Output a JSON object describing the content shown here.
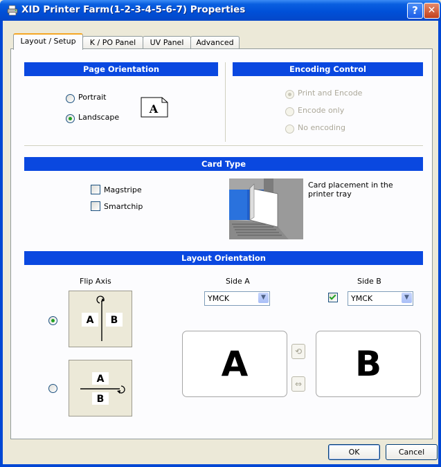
{
  "window": {
    "title": "XID Printer Farm(1-2-3-4-5-6-7) Properties",
    "help_label": "?",
    "close_label": "✕"
  },
  "tabs": [
    {
      "label": "Layout / Setup",
      "active": true
    },
    {
      "label": "K / PO Panel",
      "active": false
    },
    {
      "label": "UV Panel",
      "active": false
    },
    {
      "label": "Advanced",
      "active": false
    }
  ],
  "page_orientation": {
    "header": "Page Orientation",
    "portrait_label": "Portrait",
    "landscape_label": "Landscape",
    "selected": "Landscape",
    "icon_letter": "A"
  },
  "encoding_control": {
    "header": "Encoding Control",
    "options": [
      "Print and Encode",
      "Encode only",
      "No encoding"
    ],
    "selected": "Print and Encode",
    "enabled": false
  },
  "card_type": {
    "header": "Card Type",
    "magstripe_label": "Magstripe",
    "smartchip_label": "Smartchip",
    "magstripe_checked": false,
    "smartchip_checked": false,
    "placement_text": "Card placement in the printer tray"
  },
  "layout_orientation": {
    "header": "Layout Orientation",
    "flip_axis_label": "Flip Axis",
    "flip_vertical": {
      "left": "A",
      "right": "B",
      "selected": true
    },
    "flip_horizontal": {
      "top": "A",
      "bottom": "B",
      "selected": false
    },
    "side_a": {
      "label": "Side A",
      "value": "YMCK",
      "letter": "A"
    },
    "side_b": {
      "label": "Side B",
      "value": "YMCK",
      "letter": "B",
      "enabled": true
    }
  },
  "buttons": {
    "ok": "OK",
    "cancel": "Cancel"
  },
  "colors": {
    "header_blue": "#0a48e0",
    "title_blue": "#0050d8",
    "dialog_bg": "#ece9d8"
  }
}
